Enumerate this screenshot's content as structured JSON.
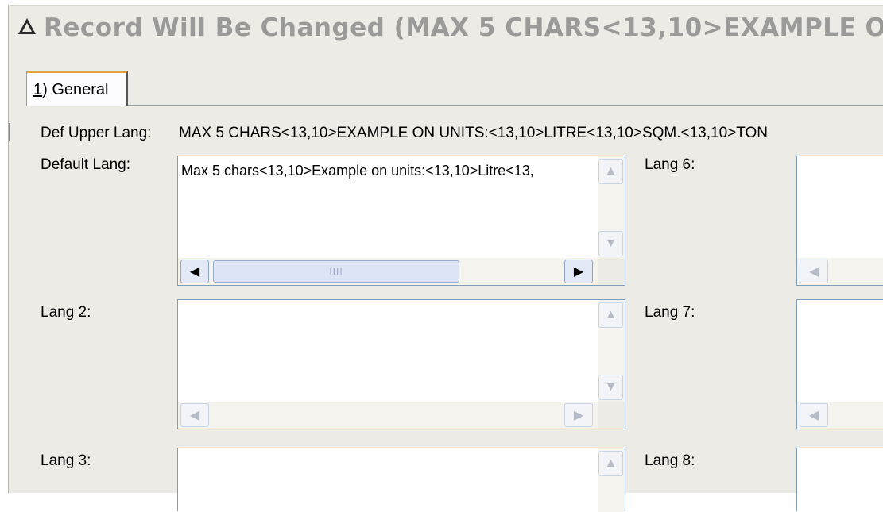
{
  "window": {
    "title": "Record Will Be Changed  (MAX 5 CHARS<13,10>EXAMPLE O"
  },
  "tabs": [
    {
      "label_number": "1",
      "label_rest": ") General"
    }
  ],
  "fields": {
    "def_upper": {
      "label": "Def Upper Lang:",
      "value": "MAX 5 CHARS<13,10>EXAMPLE ON UNITS:<13,10>LITRE<13,10>SQM.<13,10>TON"
    },
    "default_lang": {
      "label": "Default Lang:",
      "value": "Max 5 chars<13,10>Example on units:<13,10>Litre<13,"
    },
    "lang2": {
      "label": "Lang 2:",
      "value": ""
    },
    "lang3": {
      "label": "Lang 3:",
      "value": ""
    },
    "lang6": {
      "label": "Lang 6:",
      "value": ""
    },
    "lang7": {
      "label": "Lang 7:",
      "value": ""
    },
    "lang8": {
      "label": "Lang 8:",
      "value": ""
    }
  },
  "scroll": {
    "up_arrow": "▲",
    "down_arrow": "▼",
    "left_arrow": "◀",
    "right_arrow": "▶",
    "thumb_grip": "IIII"
  },
  "icons": {
    "title_icon": "warning-triangle-icon"
  }
}
